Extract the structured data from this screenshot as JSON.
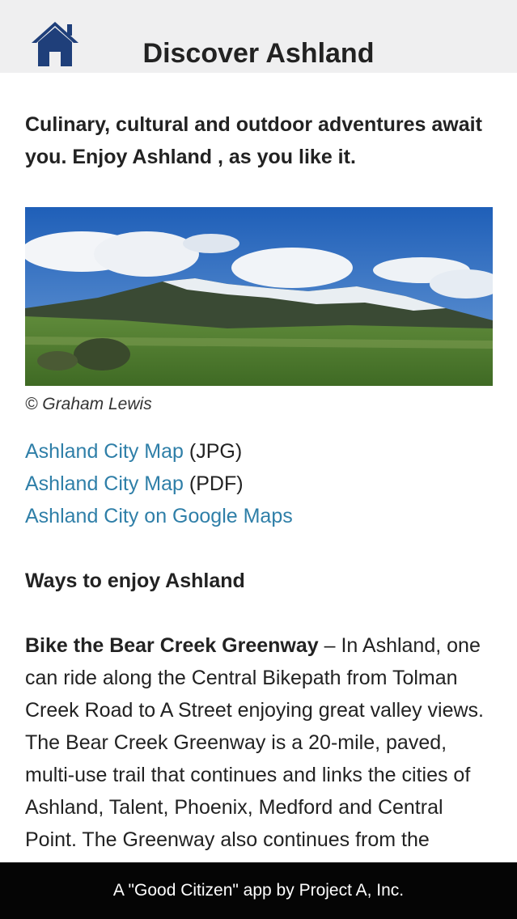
{
  "header": {
    "title": "Discover Ashland",
    "home_icon": "home-icon"
  },
  "intro": "Culinary, cultural and outdoor adventures await you. Enjoy Ashland , as you like it.",
  "photo": {
    "credit": "© Graham Lewis"
  },
  "links": [
    {
      "link_text": "Ashland City Map",
      "suffix": " (JPG)"
    },
    {
      "link_text": "Ashland City Map",
      "suffix": " (PDF)"
    },
    {
      "link_text": "Ashland City on Google Maps",
      "suffix": ""
    }
  ],
  "section": {
    "heading": "Ways to enjoy Ashland",
    "bike_title": "Bike the Bear Creek Greenway",
    "bike_text": " – In Ashland, one can ride along the Central Bikepath from Tolman Creek Road to A Street enjoying great valley views. The Bear Creek Greenway is a 20-mile, paved, multi-use trail that continues and links the cities of Ashland, Talent, Phoenix, Medford and Central Point. The Greenway also continues from the Ashland"
  },
  "footer": {
    "text": "A \"Good Citizen\" app by Project A, Inc."
  },
  "colors": {
    "link": "#2f7fa8",
    "home_icon": "#1f3f7a",
    "header_bg": "#efeff0",
    "footer_bg": "#050505"
  }
}
